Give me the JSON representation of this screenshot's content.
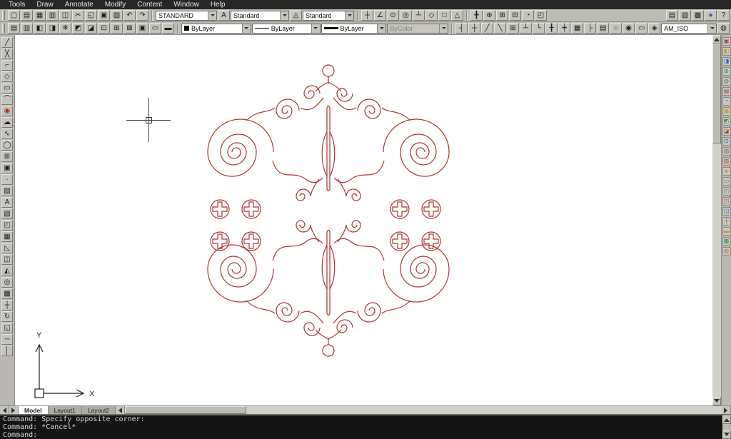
{
  "colors": {
    "ornament": "#b03232"
  },
  "menu": {
    "items": [
      "Tools",
      "Draw",
      "Annotate",
      "Modify",
      "Content",
      "Window",
      "Help"
    ]
  },
  "toolbar1": {
    "group_a": [
      {
        "name": "new-drawing-icon",
        "glyph": "▢"
      },
      {
        "name": "open-drawing-icon",
        "glyph": "▤"
      },
      {
        "name": "save-drawing-icon",
        "glyph": "▦"
      },
      {
        "name": "plot-icon",
        "glyph": "▥"
      },
      {
        "name": "plot-preview-icon",
        "glyph": "◫"
      },
      {
        "name": "cut-icon",
        "glyph": "✂"
      },
      {
        "name": "copy-clip-icon",
        "glyph": "◱"
      },
      {
        "name": "paste-icon",
        "glyph": "▣"
      },
      {
        "name": "match-properties-icon",
        "glyph": "▨"
      },
      {
        "name": "undo-icon",
        "glyph": "↶"
      },
      {
        "name": "redo-icon",
        "glyph": "↷"
      }
    ],
    "style1": "STANDARD",
    "group_b1": [
      {
        "name": "text-style-icon",
        "glyph": "A"
      }
    ],
    "style2": "Standard",
    "group_b2": [
      {
        "name": "dim-style-icon",
        "glyph": "◬"
      }
    ],
    "style3": "Standard",
    "group_c": [
      {
        "name": "snap-to-point-icon",
        "glyph": "┼"
      },
      {
        "name": "angle-snap-icon",
        "glyph": "∠"
      },
      {
        "name": "center-snap-icon",
        "glyph": "⊙"
      },
      {
        "name": "node-snap-icon",
        "glyph": "◎"
      },
      {
        "name": "ortho-icon",
        "glyph": "┴"
      },
      {
        "name": "polar-tracking-icon",
        "glyph": "◇"
      },
      {
        "name": "object-snap-icon",
        "glyph": "□"
      },
      {
        "name": "snap-track-icon",
        "glyph": "△"
      }
    ],
    "group_d": [
      {
        "name": "pan-icon",
        "glyph": "╋"
      },
      {
        "name": "zoom-realtime-icon",
        "glyph": "⊕"
      },
      {
        "name": "zoom-window-icon",
        "glyph": "⊞"
      },
      {
        "name": "zoom-previous-icon",
        "glyph": "⊟"
      },
      {
        "name": "orbit-icon",
        "glyph": "◔"
      },
      {
        "name": "named-views-icon",
        "glyph": "◰"
      }
    ],
    "group_e": [
      {
        "name": "properties-palette-icon",
        "glyph": "▤"
      },
      {
        "name": "design-center-icon",
        "glyph": "▧"
      },
      {
        "name": "tool-palettes-icon",
        "glyph": "▩"
      },
      {
        "name": "render-icon",
        "glyph": "●",
        "color": "#2a62b8"
      },
      {
        "name": "help-icon",
        "glyph": "?"
      }
    ]
  },
  "toolbar2": {
    "group_a": [
      {
        "name": "layer-properties-icon",
        "glyph": "▤"
      },
      {
        "name": "layer-states-icon",
        "glyph": "▥"
      },
      {
        "name": "layer-previous-icon",
        "glyph": "◧"
      },
      {
        "name": "layer-isolate-icon",
        "glyph": "◨"
      },
      {
        "name": "layer-freeze-icon",
        "glyph": "❄"
      },
      {
        "name": "layer-lock-icon",
        "glyph": "◩"
      },
      {
        "name": "layer-off-icon",
        "glyph": "◪"
      },
      {
        "name": "make-object-layer-icon",
        "glyph": "⊡"
      },
      {
        "name": "layer-walk-icon",
        "glyph": "⊞"
      },
      {
        "name": "layer-match-icon",
        "glyph": "⊠"
      },
      {
        "name": "color-control-icon",
        "glyph": "▣"
      },
      {
        "name": "linetype-manager-icon",
        "glyph": "▭"
      },
      {
        "name": "lineweight-settings-icon",
        "glyph": "▬"
      }
    ],
    "color": "ByLayer",
    "linetype": "ByLayer",
    "lineweight": "ByLayer",
    "plot_style": "ByColor",
    "group_b": [
      {
        "name": "power-dimension-icon",
        "glyph": "┤"
      },
      {
        "name": "multiple-dimension-icon",
        "glyph": "┼"
      },
      {
        "name": "surface-symbol-icon",
        "glyph": "╱"
      },
      {
        "name": "weld-symbol-icon",
        "glyph": "╲"
      },
      {
        "name": "feature-frame-icon",
        "glyph": "⊞"
      },
      {
        "name": "datum-symbol-icon",
        "glyph": "┴"
      },
      {
        "name": "leader-note-icon",
        "glyph": "└"
      },
      {
        "name": "centerline-icon",
        "glyph": "╂"
      },
      {
        "name": "construction-lines-icon",
        "glyph": "┿"
      },
      {
        "name": "hole-chart-icon",
        "glyph": "▦"
      },
      {
        "name": "fits-icon",
        "glyph": "├"
      },
      {
        "name": "bom-icon",
        "glyph": "▤"
      },
      {
        "name": "balloon-icon",
        "glyph": "○"
      },
      {
        "name": "part-reference-icon",
        "glyph": "◉"
      },
      {
        "name": "title-border-icon",
        "glyph": "▭"
      },
      {
        "name": "detail-view-icon",
        "glyph": "◈"
      }
    ],
    "mech_style": "AM_ISO",
    "group_c": [
      {
        "name": "mech-options-icon",
        "glyph": "◍"
      }
    ]
  },
  "left_toolbar": {
    "icons": [
      {
        "name": "line-tool-icon",
        "glyph": "╱"
      },
      {
        "name": "construction-line-icon",
        "glyph": "╳"
      },
      {
        "name": "polyline-tool-icon",
        "glyph": "⌐"
      },
      {
        "name": "polygon-tool-icon",
        "glyph": "◇"
      },
      {
        "name": "rectangle-tool-icon",
        "glyph": "▭"
      },
      {
        "name": "arc-tool-icon",
        "glyph": "⌒"
      },
      {
        "name": "circle-tool-icon",
        "glyph": "◉",
        "color": "#a03326"
      },
      {
        "name": "revision-cloud-icon",
        "glyph": "☁"
      },
      {
        "name": "spline-tool-icon",
        "glyph": "∿"
      },
      {
        "name": "ellipse-tool-icon",
        "glyph": "◯"
      },
      {
        "name": "insert-block-icon",
        "glyph": "⊞"
      },
      {
        "name": "make-block-icon",
        "glyph": "▣"
      },
      {
        "name": "point-tool-icon",
        "glyph": "∙"
      },
      {
        "name": "hatch-tool-icon",
        "glyph": "▨"
      },
      {
        "name": "multiline-text-icon",
        "glyph": "A"
      },
      {
        "name": "gradient-tool-icon",
        "glyph": "▧"
      },
      {
        "name": "region-tool-icon",
        "glyph": "◰"
      },
      {
        "name": "table-tool-icon",
        "glyph": "▦"
      },
      {
        "name": "erase-tool-icon",
        "glyph": "◺"
      },
      {
        "name": "copy-tool-icon",
        "glyph": "◫"
      },
      {
        "name": "mirror-tool-icon",
        "glyph": "◭"
      },
      {
        "name": "offset-tool-icon",
        "glyph": "◎"
      },
      {
        "name": "array-tool-icon",
        "glyph": "▩"
      },
      {
        "name": "move-tool-icon",
        "glyph": "┼"
      },
      {
        "name": "rotate-tool-icon",
        "glyph": "↻"
      },
      {
        "name": "scale-tool-icon",
        "glyph": "◱"
      },
      {
        "name": "trim-tool-icon",
        "glyph": "─"
      },
      {
        "name": "extend-tool-icon",
        "glyph": "│"
      }
    ]
  },
  "right_toolbar": {
    "icons": [
      {
        "name": "part-library-icon",
        "glyph": "▣",
        "color": "#b23b2e"
      },
      {
        "name": "screw-connection-icon",
        "glyph": "◧",
        "color": "#c79a1e"
      },
      {
        "name": "shaft-generator-icon",
        "glyph": "◨",
        "color": "#2a62b8"
      },
      {
        "name": "fea-calculation-icon",
        "glyph": "⊞",
        "color": "#2f9b4a"
      },
      {
        "name": "cam-design-icon",
        "glyph": "◍",
        "color": "#6a6a64"
      },
      {
        "name": "chain-drive-icon",
        "glyph": "▤",
        "color": "#b23b2e"
      },
      {
        "name": "spring-design-icon",
        "glyph": "◔",
        "color": "#2a62b8"
      },
      {
        "name": "belt-drive-icon",
        "glyph": "▦",
        "color": "#c79a1e"
      },
      {
        "name": "standard-parts-icon",
        "glyph": "◩",
        "color": "#2f9b4a"
      },
      {
        "name": "steel-shapes-icon",
        "glyph": "◪",
        "color": "#b23b2e"
      },
      {
        "name": "bom-list-icon",
        "glyph": "⊡",
        "color": "#2a62b8"
      },
      {
        "name": "balloons-list-icon",
        "glyph": "▧",
        "color": "#6a6a64"
      },
      {
        "name": "power-dim-icon",
        "glyph": "▥",
        "color": "#b23b2e"
      },
      {
        "name": "tolerance-icon",
        "glyph": "◈",
        "color": "#c79a1e"
      },
      {
        "name": "fits-list-icon",
        "glyph": "▭",
        "color": "#2a62b8"
      },
      {
        "name": "surface-finish-icon",
        "glyph": "◰",
        "color": "#2f9b4a"
      },
      {
        "name": "weld-symbols-icon",
        "glyph": "◳",
        "color": "#b23b2e"
      },
      {
        "name": "edge-symbols-icon",
        "glyph": "◲",
        "color": "#2a62b8"
      },
      {
        "name": "centerlines-list-icon",
        "glyph": "┼",
        "color": "#6a6a64"
      },
      {
        "name": "title-block-icon",
        "glyph": "▬",
        "color": "#c79a1e"
      },
      {
        "name": "revision-list-icon",
        "glyph": "▩",
        "color": "#2f9b4a"
      },
      {
        "name": "mech-settings-icon",
        "glyph": "◎",
        "color": "#b23b2e"
      }
    ]
  },
  "canvas": {
    "ucs": {
      "x_label": "X",
      "y_label": "Y"
    }
  },
  "tabs": {
    "items": [
      {
        "label": "Model",
        "active": true
      },
      {
        "label": "Layout1"
      },
      {
        "label": "Layout2"
      }
    ]
  },
  "command": {
    "lines": [
      "Command: Specify opposite corner:",
      "Command: *Cancel*",
      "Command:"
    ]
  }
}
